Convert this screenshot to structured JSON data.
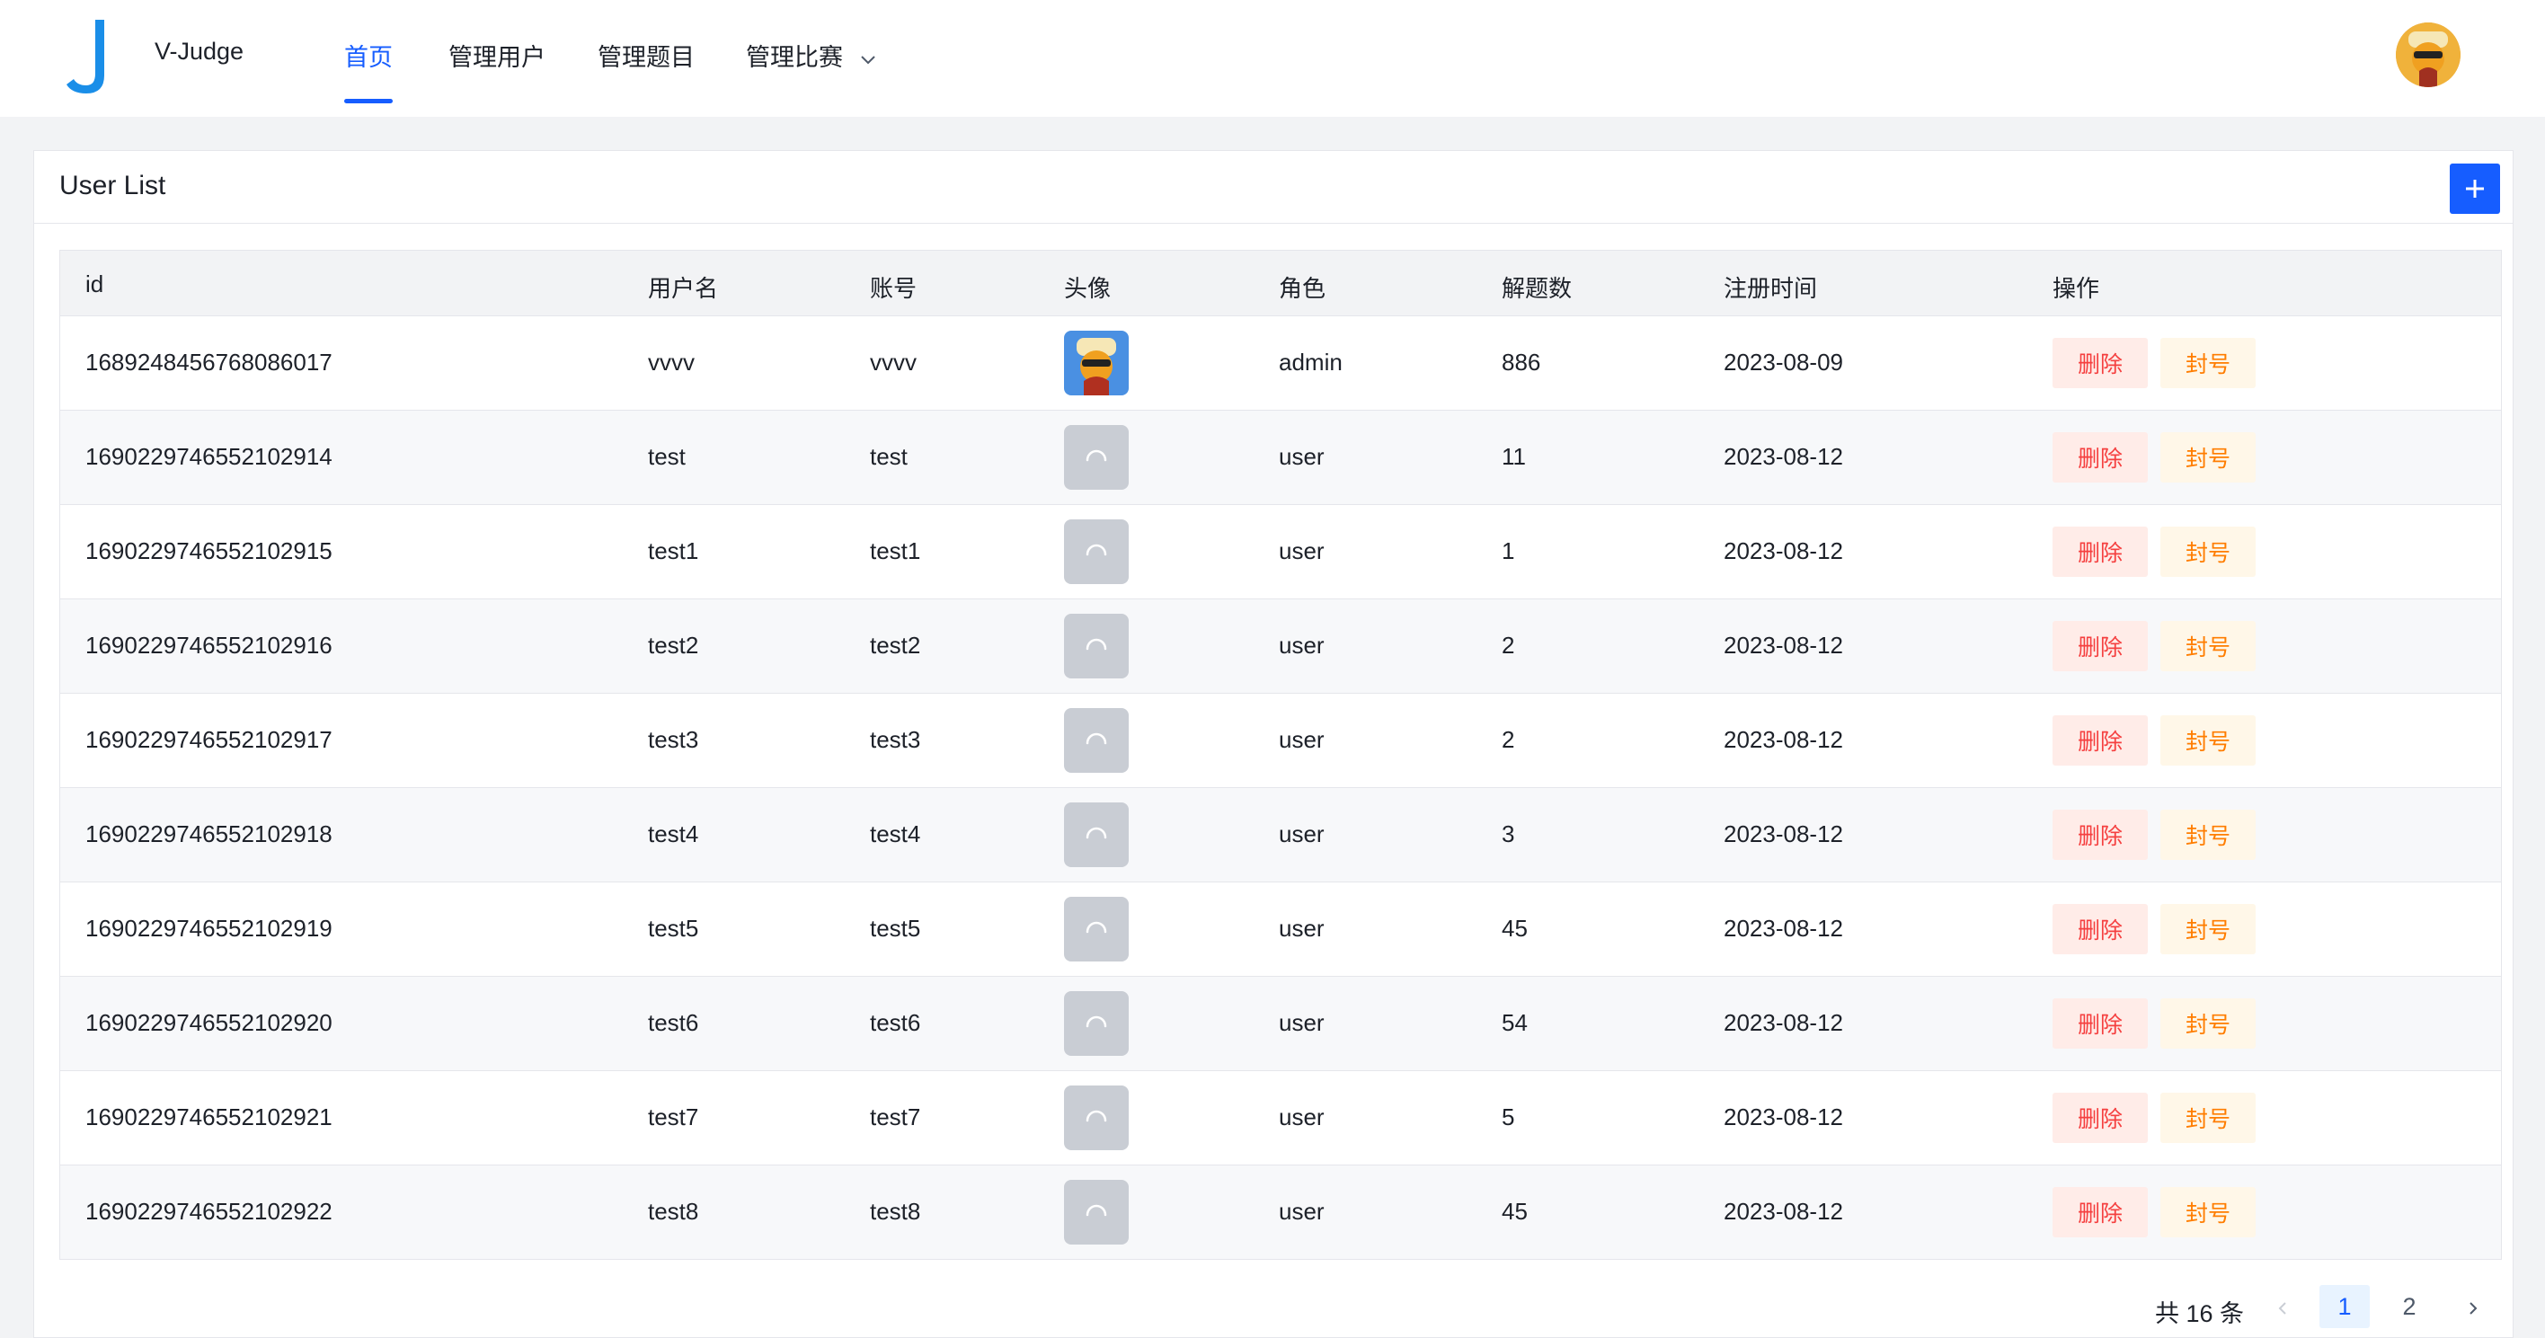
{
  "header": {
    "logo_letter": "J",
    "app_name": "V-Judge",
    "nav": [
      {
        "label": "首页",
        "active": true
      },
      {
        "label": "管理用户",
        "active": false
      },
      {
        "label": "管理题目",
        "active": false
      },
      {
        "label": "管理比赛",
        "active": false,
        "dropdown": true
      }
    ],
    "avatar_icon": "user-avatar-icon"
  },
  "card": {
    "title": "User List",
    "add_icon": "plus-icon"
  },
  "table": {
    "columns": [
      "id",
      "用户名",
      "账号",
      "头像",
      "角色",
      "解题数",
      "注册时间",
      "操作"
    ],
    "rows": [
      {
        "id": "1689248456768086017",
        "username": "vvvv",
        "account": "vvvv",
        "avatar": "image",
        "role": "admin",
        "solved": "886",
        "registered": "2023-08-09",
        "delete": "删除",
        "ban": "封号"
      },
      {
        "id": "1690229746552102914",
        "username": "test",
        "account": "test",
        "avatar": "loading",
        "role": "user",
        "solved": "11",
        "registered": "2023-08-12",
        "delete": "删除",
        "ban": "封号"
      },
      {
        "id": "1690229746552102915",
        "username": "test1",
        "account": "test1",
        "avatar": "loading",
        "role": "user",
        "solved": "1",
        "registered": "2023-08-12",
        "delete": "删除",
        "ban": "封号"
      },
      {
        "id": "1690229746552102916",
        "username": "test2",
        "account": "test2",
        "avatar": "loading",
        "role": "user",
        "solved": "2",
        "registered": "2023-08-12",
        "delete": "删除",
        "ban": "封号"
      },
      {
        "id": "1690229746552102917",
        "username": "test3",
        "account": "test3",
        "avatar": "loading",
        "role": "user",
        "solved": "2",
        "registered": "2023-08-12",
        "delete": "删除",
        "ban": "封号"
      },
      {
        "id": "1690229746552102918",
        "username": "test4",
        "account": "test4",
        "avatar": "loading",
        "role": "user",
        "solved": "3",
        "registered": "2023-08-12",
        "delete": "删除",
        "ban": "封号"
      },
      {
        "id": "1690229746552102919",
        "username": "test5",
        "account": "test5",
        "avatar": "loading",
        "role": "user",
        "solved": "45",
        "registered": "2023-08-12",
        "delete": "删除",
        "ban": "封号"
      },
      {
        "id": "1690229746552102920",
        "username": "test6",
        "account": "test6",
        "avatar": "loading",
        "role": "user",
        "solved": "54",
        "registered": "2023-08-12",
        "delete": "删除",
        "ban": "封号"
      },
      {
        "id": "1690229746552102921",
        "username": "test7",
        "account": "test7",
        "avatar": "loading",
        "role": "user",
        "solved": "5",
        "registered": "2023-08-12",
        "delete": "删除",
        "ban": "封号"
      },
      {
        "id": "1690229746552102922",
        "username": "test8",
        "account": "test8",
        "avatar": "loading",
        "role": "user",
        "solved": "45",
        "registered": "2023-08-12",
        "delete": "删除",
        "ban": "封号"
      }
    ]
  },
  "pagination": {
    "total_text": "共 16 条",
    "pages": [
      "1",
      "2"
    ],
    "current_page": "1",
    "prev_icon": "chevron-left-icon",
    "next_icon": "chevron-right-icon"
  },
  "colors": {
    "primary": "#165dff",
    "danger": "#f53f3f",
    "warning": "#ff7d00",
    "page_bg": "#f2f3f5"
  }
}
